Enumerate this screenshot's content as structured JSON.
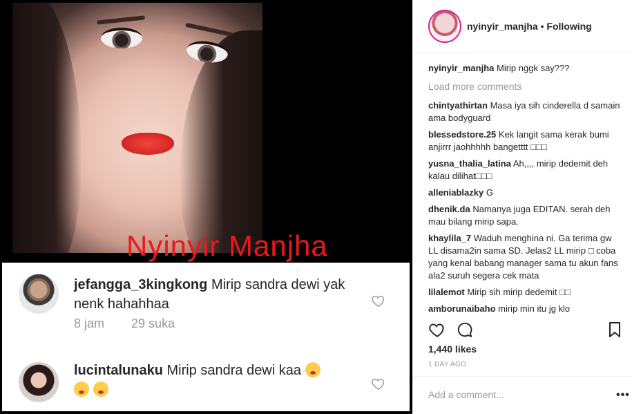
{
  "post_image": {
    "watermark": "Nyinyir Manjha",
    "comment_card": {
      "comments": [
        {
          "username": "jefangga_3kingkong",
          "text": "Mirip sandra dewi yak nenk hahahhaa",
          "time": "8 jam",
          "likes": "29 suka"
        },
        {
          "username": "lucintalunaku",
          "text": "Mirip sandra dewi kaa"
        }
      ]
    }
  },
  "header": {
    "username": "nyinyir_manjha",
    "separator": "•",
    "follow_state": "Following"
  },
  "caption": {
    "username": "nyinyir_manjha",
    "text": "Mirip nggk say???"
  },
  "load_more": "Load more comments",
  "comments": [
    {
      "username": "chintyathirtan",
      "text": "Masa iya sih cinderella d samain ama bodyguard"
    },
    {
      "username": "blessedstore.25",
      "text": "Kek langit sama kerak bumi anjirrr jaohhhhh bangetttt □□□"
    },
    {
      "username": "yusna_thalia_latina",
      "text": "Ah,,,, mirip dedemit deh kalau dilihat□□□"
    },
    {
      "username": "alleniablazky",
      "text": "G"
    },
    {
      "username": "dhenik.da",
      "text": "Namanya juga EDITAN. serah deh mau bilang mirip sapa."
    },
    {
      "username": "khaylila_7",
      "text": "Waduh menghina ni. Ga terima gw LL disama2in sama SD. Jelas2 LL mirip □ coba yang kenal babang manager sama tu akun fans ala2 suruh segera cek mata"
    },
    {
      "username": "lilalemot",
      "text": "Mirip sih mirip dedemit □□"
    },
    {
      "username": "amborunaibaho",
      "text": "mirip min itu jg klo"
    }
  ],
  "likes": "1,440 likes",
  "date": "1 DAY AGO",
  "add_comment_placeholder": "Add a comment...",
  "more": "•••",
  "colors": {
    "accent": "#e8191c",
    "muted": "#999999",
    "text": "#262626"
  }
}
